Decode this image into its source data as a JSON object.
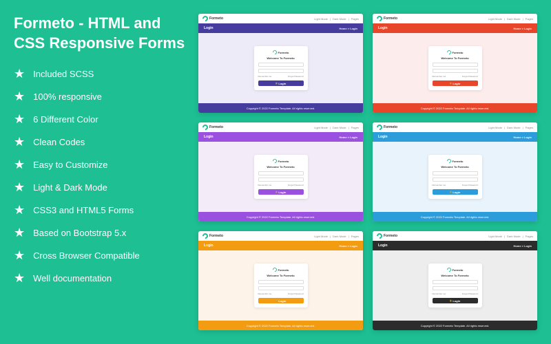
{
  "title": "Formeto - HTML and CSS Responsive Forms",
  "features": [
    "Included SCSS",
    "100% responsive",
    "6 Different Color",
    "Clean Codes",
    "Easy to Customize",
    "Light & Dark Mode",
    "CSS3 and HTML5 Forms",
    "Based on Bootstrap 5.x",
    "Cross Browser Compatible",
    "Well documentation"
  ],
  "preview": {
    "brand": "Formeto",
    "nav_links": [
      "Light Mode",
      "Dark Mode",
      "Pages"
    ],
    "bar_title": "Login",
    "breadcrumb": "Home > Login",
    "card_welcome": "Welcome To Formeto",
    "remember": "Remember me",
    "forgot": "Forgot Password",
    "login_btn": "Login",
    "footer": "Copyright © 2022 Formeto Template. All rights reserved."
  },
  "themes": [
    {
      "key": "indigo",
      "color": "#453c9e"
    },
    {
      "key": "red",
      "color": "#e8462a"
    },
    {
      "key": "purple",
      "color": "#9b51e0"
    },
    {
      "key": "blue",
      "color": "#2d9cdb"
    },
    {
      "key": "orange",
      "color": "#f39c12"
    },
    {
      "key": "black",
      "color": "#2c2c2c"
    }
  ]
}
